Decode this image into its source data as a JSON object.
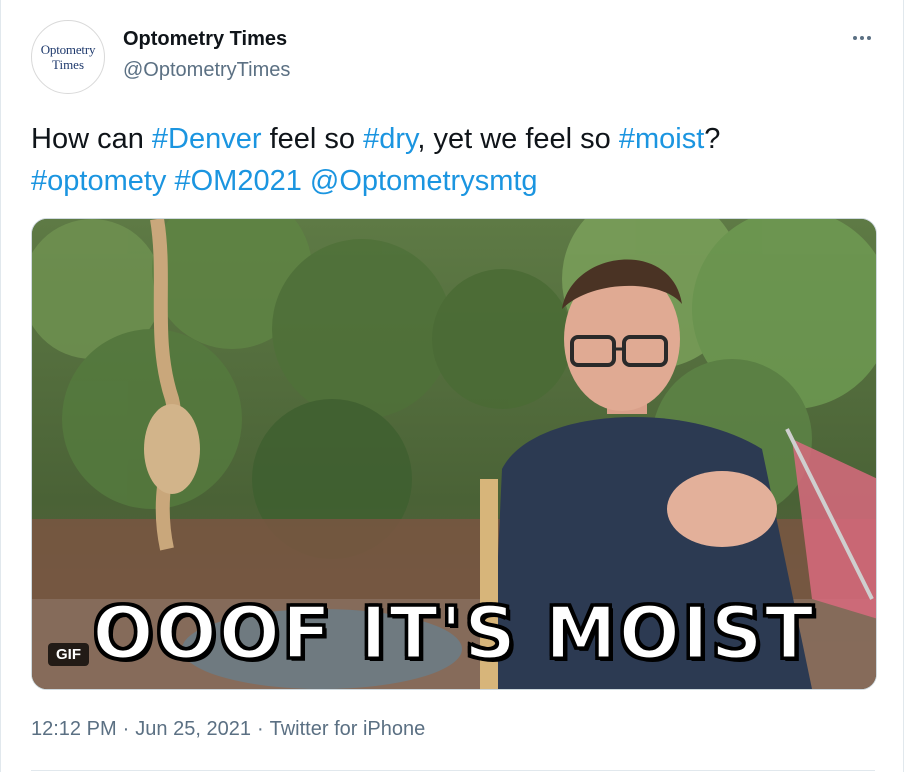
{
  "account": {
    "display_name": "Optometry Times",
    "handle": "@OptometryTimes",
    "avatar_line1": "Optometry",
    "avatar_line2": "Times"
  },
  "more_icon": "more-horizontal-icon",
  "tweet": {
    "text_1": "How can ",
    "tag_1": "#Denver",
    "text_2": " feel so ",
    "tag_2": "#dry",
    "text_3": ", yet we feel so ",
    "tag_3": "#moist",
    "text_4": "?",
    "tag_4": "#optomety",
    "tag_5": "#OM2021",
    "mention_1": "@Optometrysmtg"
  },
  "media": {
    "caption": "OOOF IT'S MOIST",
    "badge": "GIF"
  },
  "meta": {
    "time": "12:12 PM",
    "separator": "·",
    "date": "Jun 25, 2021",
    "source": "Twitter for iPhone"
  },
  "colors": {
    "link": "#1b95e0",
    "muted": "#5b7083",
    "text": "#0f1419"
  }
}
